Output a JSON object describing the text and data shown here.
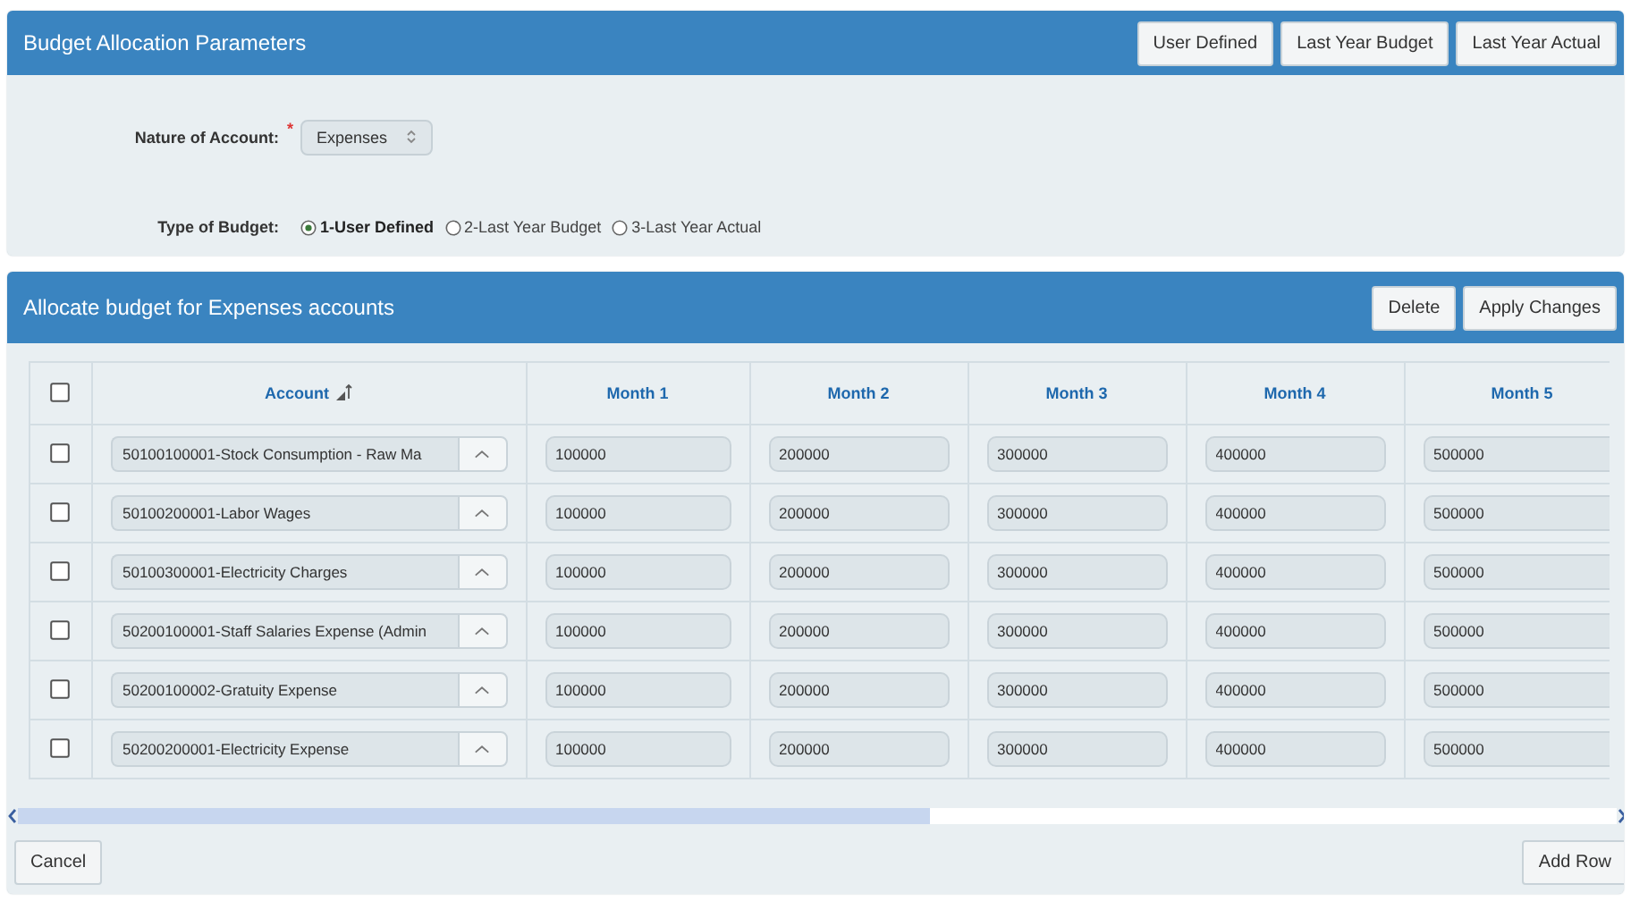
{
  "params": {
    "title": "Budget Allocation Parameters",
    "buttons": [
      "User Defined",
      "Last Year Budget",
      "Last Year Actual"
    ],
    "nature": {
      "label": "Nature of Account:",
      "required_mark": "*",
      "value": "Expenses"
    },
    "type_of_budget": {
      "label": "Type of Budget:",
      "options": [
        {
          "label": "1-User Defined",
          "selected": true
        },
        {
          "label": "2-Last Year Budget",
          "selected": false
        },
        {
          "label": "3-Last Year Actual",
          "selected": false
        }
      ]
    }
  },
  "grid": {
    "title": "Allocate budget for Expenses accounts",
    "buttons": [
      "Delete",
      "Apply Changes"
    ],
    "select_all": {
      "checked": false
    },
    "columns": [
      "Account",
      "Month 1",
      "Month 2",
      "Month 3",
      "Month 4",
      "Month 5"
    ],
    "rows": [
      {
        "checked": false,
        "account": "50100100001-Stock Consumption - Raw Ma",
        "months": [
          "100000",
          "200000",
          "300000",
          "400000",
          "500000"
        ]
      },
      {
        "checked": false,
        "account": "50100200001-Labor Wages",
        "months": [
          "100000",
          "200000",
          "300000",
          "400000",
          "500000"
        ]
      },
      {
        "checked": false,
        "account": "50100300001-Electricity Charges",
        "months": [
          "100000",
          "200000",
          "300000",
          "400000",
          "500000"
        ]
      },
      {
        "checked": false,
        "account": "50200100001-Staff Salaries Expense (Admin",
        "months": [
          "100000",
          "200000",
          "300000",
          "400000",
          "500000"
        ]
      },
      {
        "checked": false,
        "account": "50200100002-Gratuity Expense",
        "months": [
          "100000",
          "200000",
          "300000",
          "400000",
          "500000"
        ]
      },
      {
        "checked": false,
        "account": "50200200001-Electricity Expense",
        "months": [
          "100000",
          "200000",
          "300000",
          "400000",
          "500000"
        ]
      }
    ]
  },
  "footer": {
    "buttons": [
      "Cancel",
      "Add Row"
    ]
  }
}
